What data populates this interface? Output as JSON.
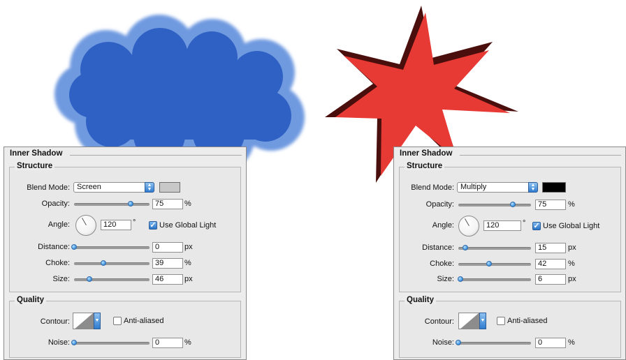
{
  "left_panel": {
    "title": "Inner Shadow",
    "structure_label": "Structure",
    "blend_mode_label": "Blend Mode:",
    "blend_mode_value": "Screen",
    "shadow_color": "#c8c8c8",
    "opacity_label": "Opacity:",
    "opacity_value": "75",
    "opacity_unit": "%",
    "opacity_slider": 0.75,
    "angle_label": "Angle:",
    "angle_value": "120",
    "angle_unit": "°",
    "global_light_label": "Use Global Light",
    "global_light_checked": true,
    "distance_label": "Distance:",
    "distance_value": "0",
    "distance_unit": "px",
    "distance_slider": 0.0,
    "choke_label": "Choke:",
    "choke_value": "39",
    "choke_unit": "%",
    "choke_slider": 0.39,
    "size_label": "Size:",
    "size_value": "46",
    "size_unit": "px",
    "size_slider": 0.2,
    "quality_label": "Quality",
    "contour_label": "Contour:",
    "anti_aliased_label": "Anti-aliased",
    "anti_aliased_checked": false,
    "noise_label": "Noise:",
    "noise_value": "0",
    "noise_unit": "%",
    "noise_slider": 0.0
  },
  "right_panel": {
    "title": "Inner Shadow",
    "structure_label": "Structure",
    "blend_mode_label": "Blend Mode:",
    "blend_mode_value": "Multiply",
    "shadow_color": "#000000",
    "opacity_label": "Opacity:",
    "opacity_value": "75",
    "opacity_unit": "%",
    "opacity_slider": 0.75,
    "angle_label": "Angle:",
    "angle_value": "120",
    "angle_unit": "°",
    "global_light_label": "Use Global Light",
    "global_light_checked": true,
    "distance_label": "Distance:",
    "distance_value": "15",
    "distance_unit": "px",
    "distance_slider": 0.1,
    "choke_label": "Choke:",
    "choke_value": "42",
    "choke_unit": "%",
    "choke_slider": 0.42,
    "size_label": "Size:",
    "size_value": "6",
    "size_unit": "px",
    "size_slider": 0.03,
    "quality_label": "Quality",
    "contour_label": "Contour:",
    "anti_aliased_label": "Anti-aliased",
    "anti_aliased_checked": false,
    "noise_label": "Noise:",
    "noise_value": "0",
    "noise_unit": "%",
    "noise_slider": 0.0
  },
  "colors": {
    "cloud_fill": "#2f61c4",
    "cloud_edge": "#6f9ae0",
    "starburst_fill": "#e83a34",
    "starburst_shadow": "#4a0e0c"
  }
}
